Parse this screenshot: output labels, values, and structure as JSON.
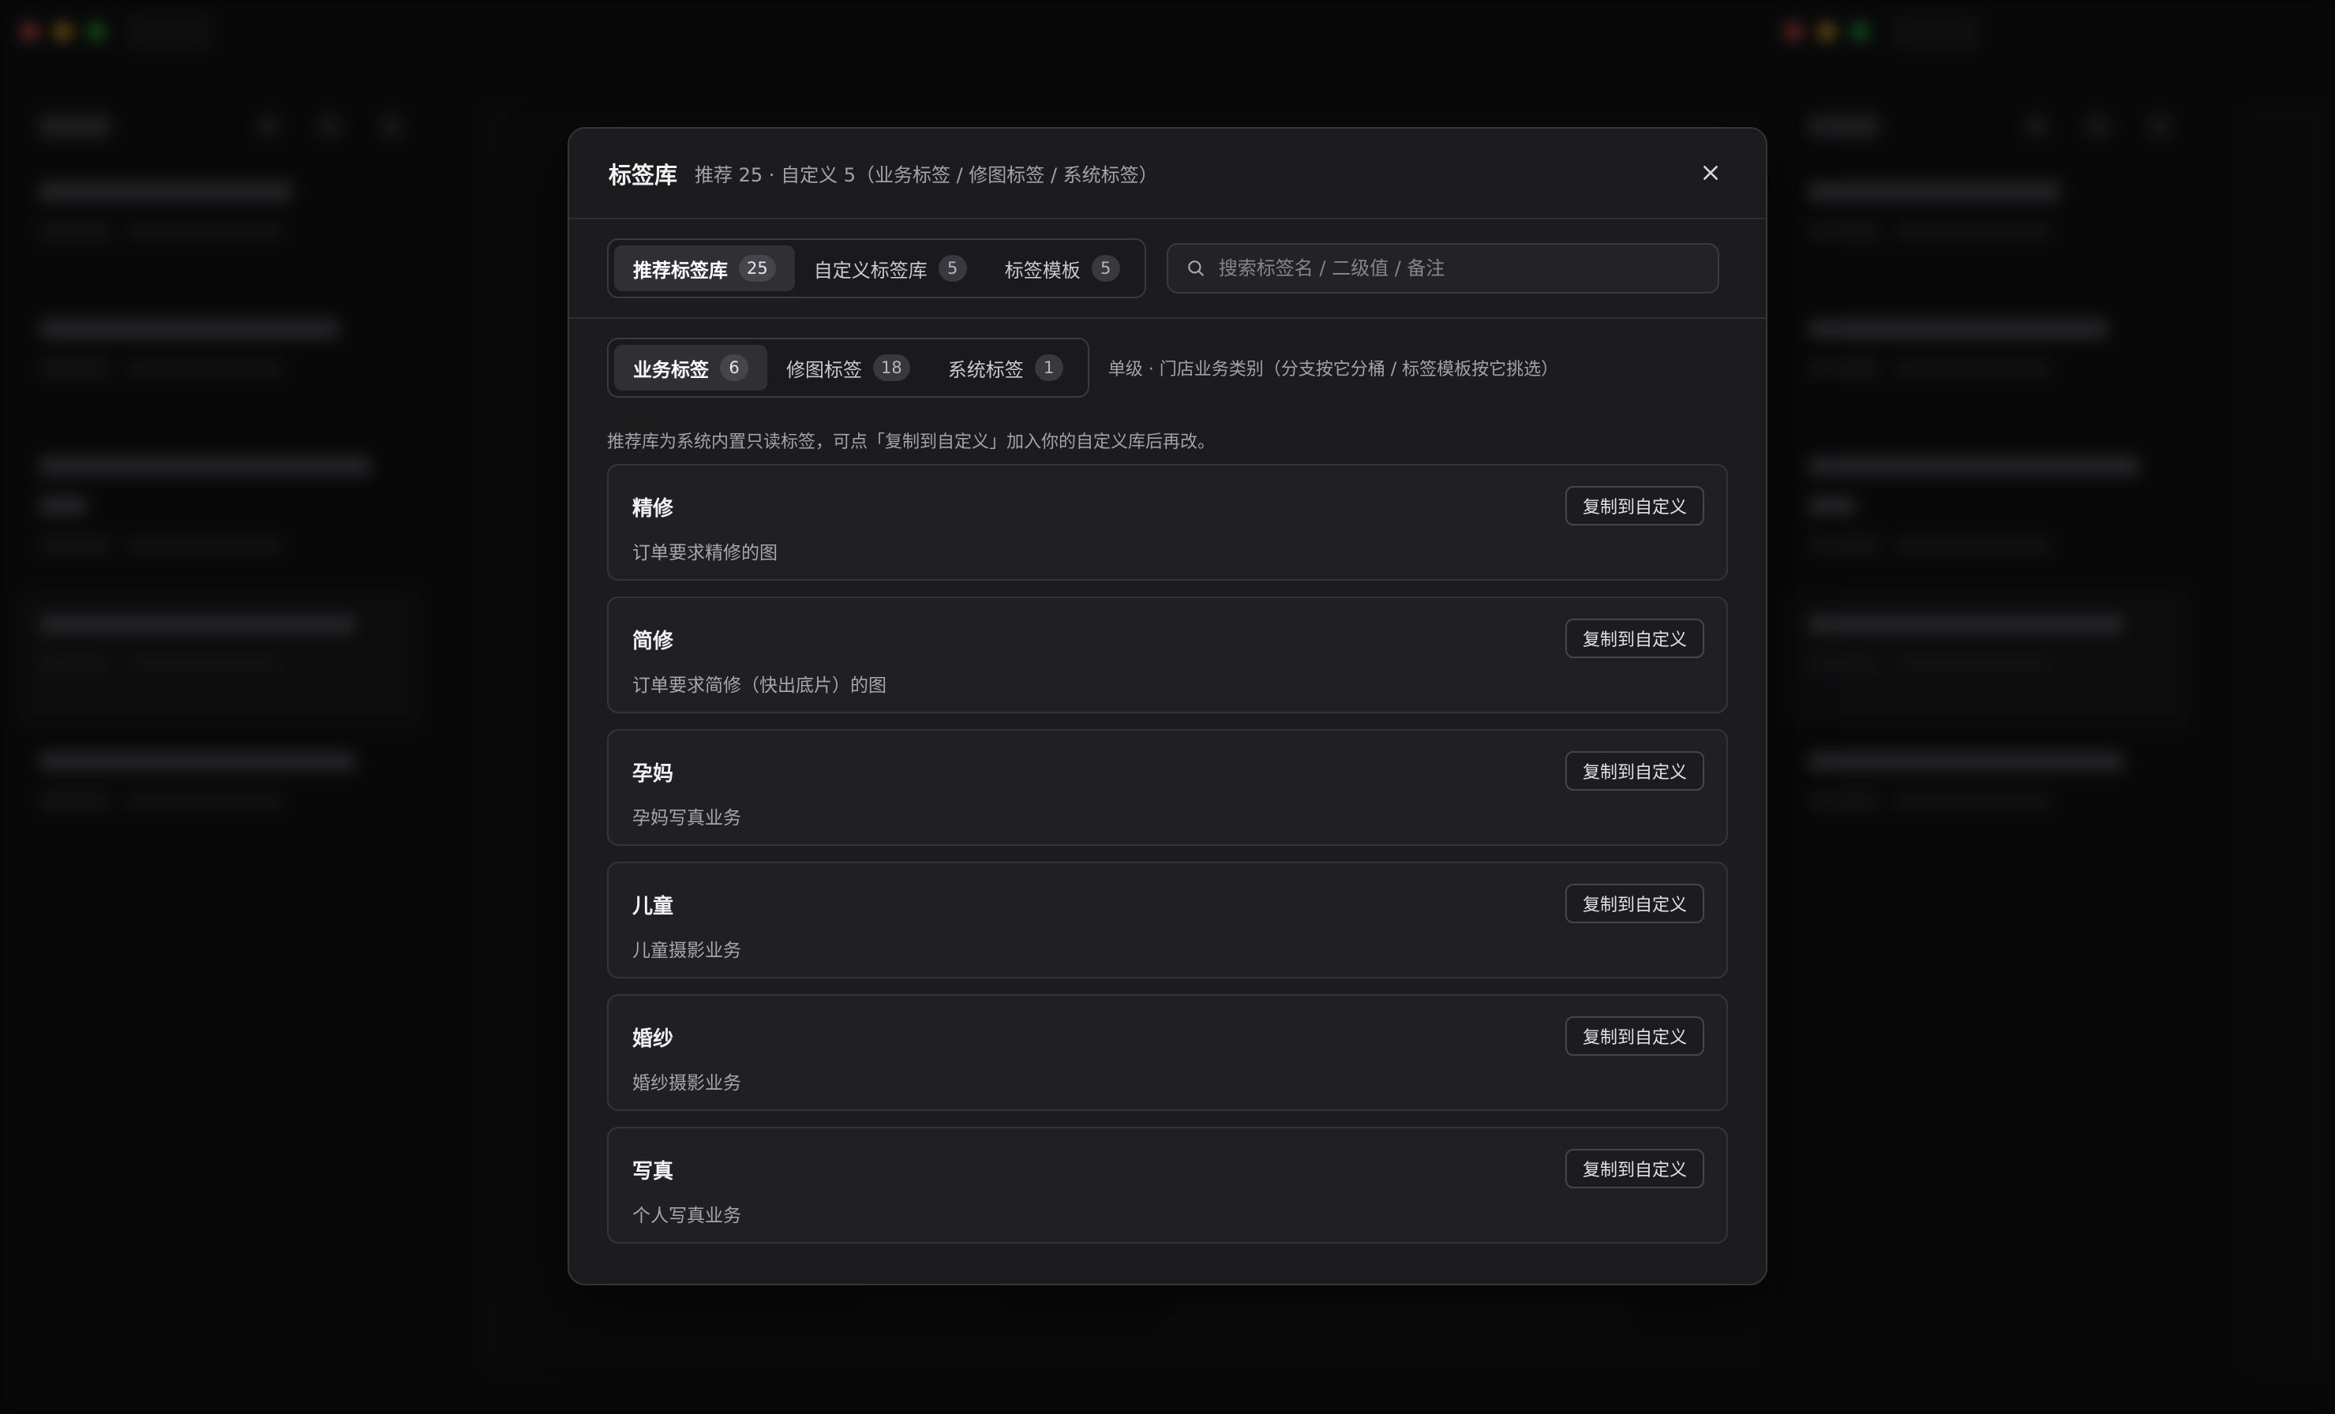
{
  "modal": {
    "title": "标签库",
    "subtitle": "推荐 25 · 自定义 5（业务标签 / 修图标签 / 系统标签）",
    "close_icon": "close-icon"
  },
  "library_tabs": [
    {
      "label": "推荐标签库",
      "count": "25",
      "active": true
    },
    {
      "label": "自定义标签库",
      "count": "5",
      "active": false
    },
    {
      "label": "标签模板",
      "count": "5",
      "active": false
    }
  ],
  "search": {
    "placeholder": "搜索标签名 / 二级值 / 备注",
    "value": "",
    "icon": "search-icon"
  },
  "category_tabs": [
    {
      "label": "业务标签",
      "count": "6",
      "active": true
    },
    {
      "label": "修图标签",
      "count": "18",
      "active": false
    },
    {
      "label": "系统标签",
      "count": "1",
      "active": false
    }
  ],
  "category_hint": "单级 · 门店业务类别（分支按它分桶 / 标签模板按它挑选）",
  "note": "推荐库为系统内置只读标签，可点「复制到自定义」加入你的自定义库后再改。",
  "copy_button_label": "复制到自定义",
  "tags": [
    {
      "name": "精修",
      "desc": "订单要求精修的图"
    },
    {
      "name": "简修",
      "desc": "订单要求简修（快出底片）的图"
    },
    {
      "name": "孕妈",
      "desc": "孕妈写真业务"
    },
    {
      "name": "儿童",
      "desc": "儿童摄影业务"
    },
    {
      "name": "婚纱",
      "desc": "婚纱摄影业务"
    },
    {
      "name": "写真",
      "desc": "个人写真业务"
    }
  ],
  "colors": {
    "modal_bg": "#1c1c1f",
    "card_bg": "#202024",
    "active_tab_bg": "#2f2f34",
    "border": "#34343a"
  }
}
